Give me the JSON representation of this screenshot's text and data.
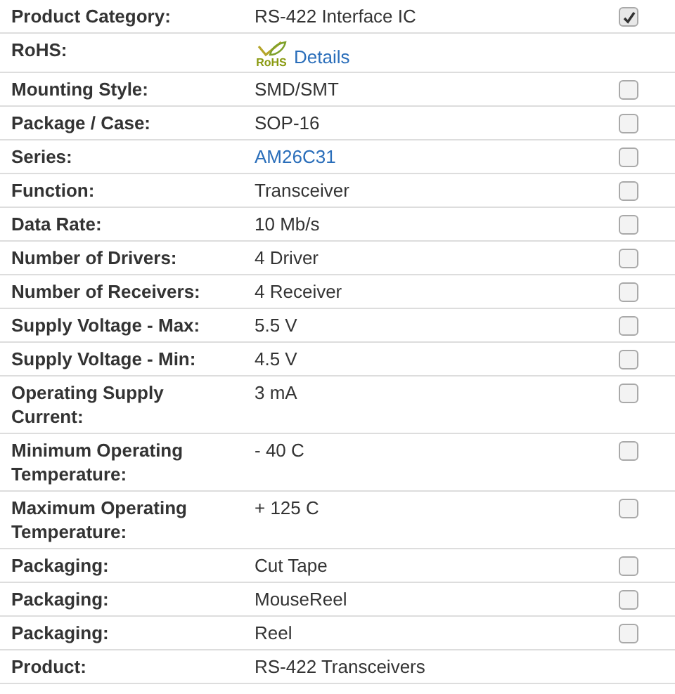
{
  "rows": [
    {
      "label": "Product Category:",
      "kind": "text",
      "value": "RS-422 Interface IC",
      "checked": true
    },
    {
      "label": "RoHS:",
      "kind": "rohs",
      "badge": "RoHS",
      "value": "Details"
    },
    {
      "label": "Mounting Style:",
      "kind": "text",
      "value": "SMD/SMT",
      "checked": false
    },
    {
      "label": "Package / Case:",
      "kind": "text",
      "value": "SOP-16",
      "checked": false
    },
    {
      "label": "Series:",
      "kind": "link",
      "value": "AM26C31",
      "checked": false
    },
    {
      "label": "Function:",
      "kind": "text",
      "value": "Transceiver",
      "checked": false
    },
    {
      "label": "Data Rate:",
      "kind": "text",
      "value": "10 Mb/s",
      "checked": false
    },
    {
      "label": "Number of Drivers:",
      "kind": "text",
      "value": "4 Driver",
      "checked": false
    },
    {
      "label": "Number of Receivers:",
      "kind": "text",
      "value": "4 Receiver",
      "checked": false
    },
    {
      "label": "Supply Voltage - Max:",
      "kind": "text",
      "value": "5.5 V",
      "checked": false
    },
    {
      "label": "Supply Voltage - Min:",
      "kind": "text",
      "value": "4.5 V",
      "checked": false
    },
    {
      "label": "Operating Supply Current:",
      "kind": "text",
      "value": "3 mA",
      "checked": false
    },
    {
      "label": "Minimum Operating Temperature:",
      "kind": "text",
      "value": "- 40 C",
      "checked": false
    },
    {
      "label": "Maximum Operating Temperature:",
      "kind": "text",
      "value": "+ 125 C",
      "checked": false
    },
    {
      "label": "Packaging:",
      "kind": "text",
      "value": "Cut Tape",
      "checked": false
    },
    {
      "label": "Packaging:",
      "kind": "text",
      "value": "MouseReel",
      "checked": false
    },
    {
      "label": "Packaging:",
      "kind": "text",
      "value": "Reel",
      "checked": false
    },
    {
      "label": "Product:",
      "kind": "text",
      "value": "RS-422 Transceivers"
    }
  ]
}
